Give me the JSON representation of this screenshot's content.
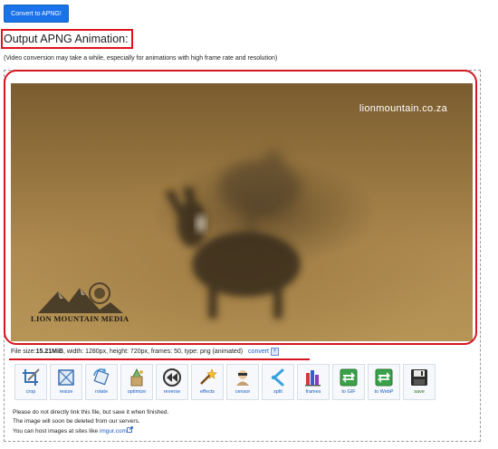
{
  "header": {
    "convert_button_label": "Convert to APNG!",
    "title": "Output APNG Animation:",
    "note": "(Video conversion may take a while, especially for animations with high frame rate and resolution)"
  },
  "preview": {
    "watermark": "lionmountain.co.za",
    "logo_text": "LION MOUNTAIN MEDIA"
  },
  "file_info": {
    "size_label": "File size: ",
    "size_value": "15.21MiB",
    "details": ", width: 1280px, height: 720px, frames: 50, type: png (animated)",
    "convert_label": "convert",
    "convert_plus": "+"
  },
  "tools": [
    {
      "label": "crop",
      "icon": "crop-icon"
    },
    {
      "label": "resize",
      "icon": "resize-icon"
    },
    {
      "label": "rotate",
      "icon": "rotate-icon"
    },
    {
      "label": "optimize",
      "icon": "optimize-icon"
    },
    {
      "label": "reverse",
      "icon": "reverse-icon"
    },
    {
      "label": "effects",
      "icon": "effects-icon"
    },
    {
      "label": "censor",
      "icon": "censor-icon"
    },
    {
      "label": "split",
      "icon": "split-icon"
    },
    {
      "label": "frames",
      "icon": "frames-icon"
    },
    {
      "label": "to GIF",
      "icon": "to-gif-icon"
    },
    {
      "label": "to WebP",
      "icon": "to-webp-icon"
    },
    {
      "label": "save",
      "icon": "save-icon"
    }
  ],
  "footer": {
    "line1": "Please do not directly link this file, but save it when finished.",
    "line2": "The image will soon be deleted from our servers.",
    "line3_prefix": "You can host images at sites like ",
    "line3_link": "imgur.com"
  }
}
